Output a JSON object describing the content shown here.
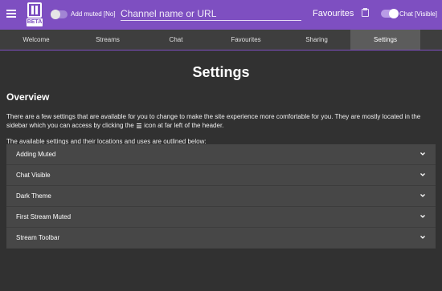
{
  "header": {
    "logo_text": "BETA",
    "adding_muted_label": "Add muted [No]",
    "search_placeholder": "Channel name or URL",
    "favourites_label": "Favourites",
    "chat_toggle_label": "Chat [Visible]",
    "accent_color": "#7e4fc1"
  },
  "tabs": [
    {
      "label": "Welcome",
      "active": false
    },
    {
      "label": "Streams",
      "active": false
    },
    {
      "label": "Chat",
      "active": false
    },
    {
      "label": "Favourites",
      "active": false
    },
    {
      "label": "Sharing",
      "active": false
    },
    {
      "label": "Settings",
      "active": true
    }
  ],
  "main": {
    "title": "Settings",
    "overview_heading": "Overview",
    "overview_text_before_icon": "There are a few settings that are available for you to change to make the site experience more comfortable for you. They are mostly located in the sidebar which you can access by clicking the",
    "overview_text_after_icon": "icon at far left of the header.",
    "intro_text": "The available settings and their locations and uses are outlined below:",
    "settings_items": [
      {
        "label": "Adding Muted"
      },
      {
        "label": "Chat Visible"
      },
      {
        "label": "Dark Theme"
      },
      {
        "label": "First Stream Muted"
      },
      {
        "label": "Stream Toolbar"
      }
    ]
  }
}
